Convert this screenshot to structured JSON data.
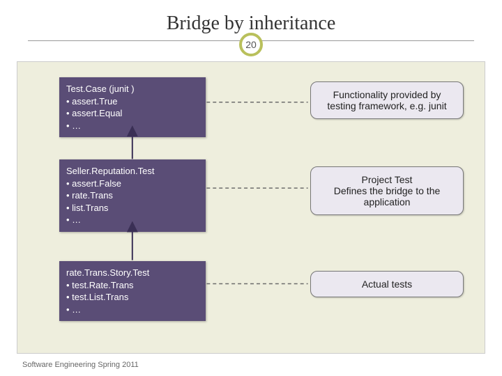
{
  "title": "Bridge by inheritance",
  "page_number": "20",
  "footer": "Software Engineering Spring 2011",
  "boxes": {
    "top": {
      "title": "Test.Case (junit )",
      "items": [
        "assert.True",
        "assert.Equal",
        "…"
      ]
    },
    "mid": {
      "title": "Seller.Reputation.Test",
      "items": [
        "assert.False",
        "rate.Trans",
        "list.Trans",
        "…"
      ]
    },
    "bot": {
      "title": "rate.Trans.Story.Test",
      "items": [
        "test.Rate.Trans",
        "test.List.Trans",
        "…"
      ]
    }
  },
  "callouts": {
    "top": "Functionality provided by testing framework, e.g. junit",
    "mid": "Project Test\nDefines the bridge to the application",
    "bot": "Actual tests"
  }
}
